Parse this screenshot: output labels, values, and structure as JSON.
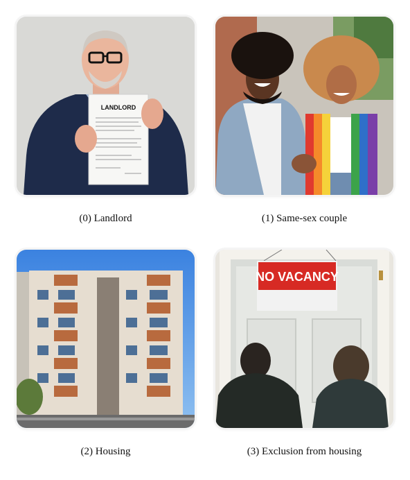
{
  "panels": [
    {
      "caption": "(0) Landlord",
      "image": "man-holding-document-photo",
      "document_heading": "LANDLORD"
    },
    {
      "caption": "(1) Same-sex couple",
      "image": "smiling-couple-holding-hands-photo"
    },
    {
      "caption": "(2) Housing",
      "image": "apartment-building-photo"
    },
    {
      "caption": "(3) Exclusion from housing",
      "image": "two-people-at-door-with-sign-photo",
      "sign_text": "NO VACANCY"
    }
  ]
}
